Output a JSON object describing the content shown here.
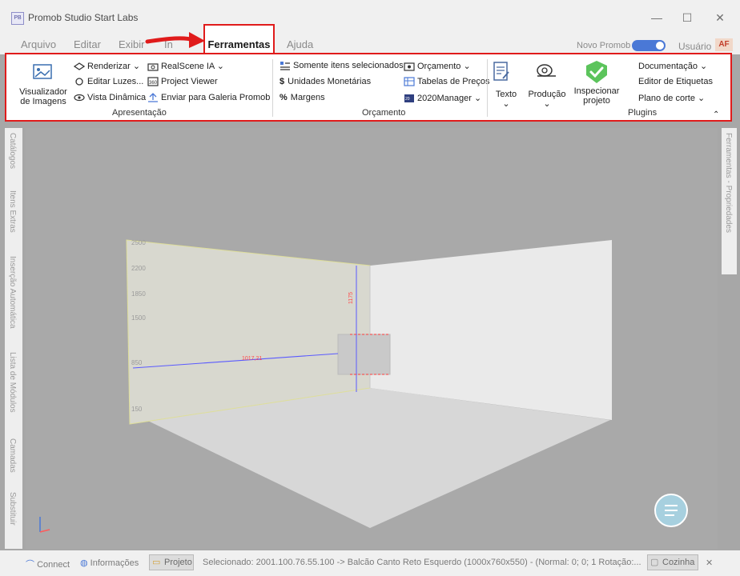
{
  "window": {
    "title": "Promob Studio Start Labs",
    "icon_text": "PB"
  },
  "menu": {
    "items": [
      "Arquivo",
      "Editar",
      "Exibir",
      "In",
      "Ferramentas",
      "Ajuda"
    ],
    "active": "Ferramentas",
    "toggle_label": "Novo Promob",
    "user_label": "Usuário",
    "user_badge": "AF"
  },
  "ribbon": {
    "apresentacao": {
      "big_button": "Visualizador de Imagens",
      "renderizar": "Renderizar",
      "editar_luzes": "Editar Luzes...",
      "vista_dinamica": "Vista Dinâmica",
      "realscene": "RealScene IA",
      "project_viewer": "Project Viewer",
      "enviar_galeria": "Enviar para Galeria Promob",
      "group_label": "Apresentação"
    },
    "orcamento": {
      "somente_itens": "Somente itens selecionados",
      "unidades_monetarias": "Unidades Monetárias",
      "margens": "Margens",
      "orcamento_btn": "Orçamento",
      "tabelas_precos": "Tabelas de Preços",
      "manager_2020": "2020Manager",
      "group_label": "Orçamento"
    },
    "plugins": {
      "texto": "Texto",
      "producao": "Produção",
      "inspecionar": "Inspecionar projeto",
      "documentacao": "Documentação",
      "editor_etiquetas": "Editor de Etiquetas",
      "plano_corte": "Plano de corte",
      "group_label": "Plugins"
    }
  },
  "left_tabs": [
    "Catálogos",
    "Itens Extras",
    "Inserção Automática",
    "Lista de Módulos",
    "Camadas",
    "Substituir"
  ],
  "right_tabs": [
    "Ferramentas - Propriedades"
  ],
  "viewport": {
    "height_marks": [
      "2500",
      "2200",
      "1850",
      "1500",
      "850",
      "150"
    ],
    "dimension_text": "1017,21",
    "vertical_dimension": "1175"
  },
  "status": {
    "connect": "Connect",
    "informacoes": "Informações",
    "projeto": "Projeto",
    "selection_text": "Selecionado: 2001.100.76.55.100 -> Balcão Canto Reto Esquerdo (1000x760x550) - (Normal: 0; 0; 1 Rotação:...",
    "environment": "Cozinha"
  },
  "colors": {
    "highlight_red": "#e01b1b",
    "accent_blue": "#4a78d6",
    "check_green": "#5cc45c"
  }
}
